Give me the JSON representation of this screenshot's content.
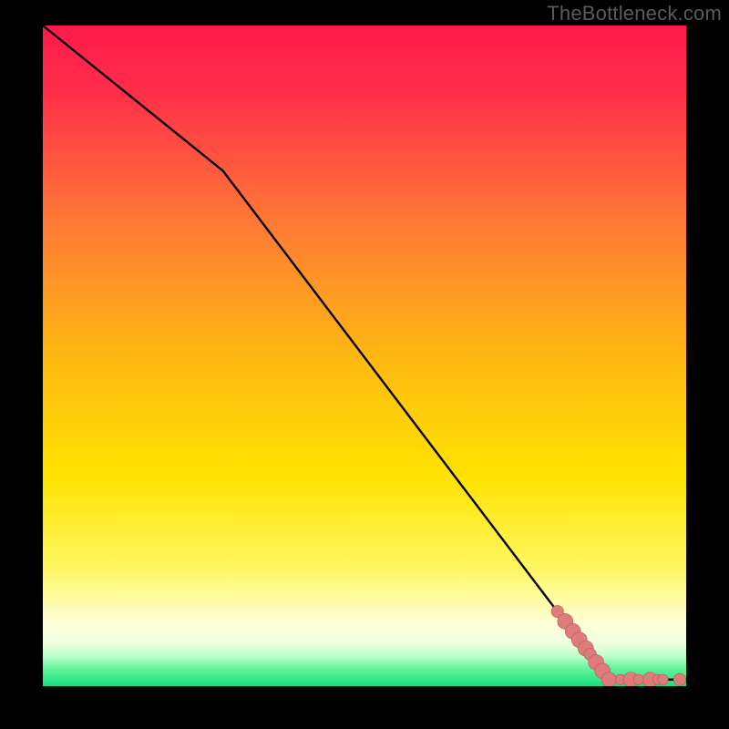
{
  "attribution": "TheBottleneck.com",
  "colors": {
    "background": "#000000",
    "gradient_top": "#ff1a4a",
    "gradient_mid_upper": "#ff8a2a",
    "gradient_mid": "#ffd400",
    "gradient_pale": "#ffffc0",
    "gradient_green_light": "#7dfda0",
    "gradient_green": "#17e07e",
    "curve": "#000000",
    "marker_fill": "#dd7c78",
    "marker_stroke": "#b85a58"
  },
  "chart_data": {
    "type": "line",
    "xlim": [
      0,
      100
    ],
    "ylim": [
      0,
      100
    ],
    "title": "",
    "xlabel": "",
    "ylabel": "",
    "grid": false,
    "curve": [
      {
        "x": 0,
        "y": 100
      },
      {
        "x": 28,
        "y": 78
      },
      {
        "x": 88,
        "y": 1
      },
      {
        "x": 100,
        "y": 1
      }
    ],
    "markers": [
      {
        "x": 80.0,
        "y": 11.3,
        "r": 1.9
      },
      {
        "x": 81.2,
        "y": 9.8,
        "r": 2.4
      },
      {
        "x": 82.4,
        "y": 8.3,
        "r": 2.4
      },
      {
        "x": 83.4,
        "y": 7.0,
        "r": 2.4
      },
      {
        "x": 84.4,
        "y": 5.7,
        "r": 2.4
      },
      {
        "x": 85.1,
        "y": 4.8,
        "r": 1.9
      },
      {
        "x": 86.0,
        "y": 3.6,
        "r": 2.4
      },
      {
        "x": 87.0,
        "y": 2.3,
        "r": 2.4
      },
      {
        "x": 88.0,
        "y": 1.0,
        "r": 2.3
      },
      {
        "x": 89.8,
        "y": 1.0,
        "r": 1.6
      },
      {
        "x": 91.4,
        "y": 1.0,
        "r": 2.3
      },
      {
        "x": 92.6,
        "y": 1.0,
        "r": 1.6
      },
      {
        "x": 94.4,
        "y": 1.0,
        "r": 2.3
      },
      {
        "x": 95.6,
        "y": 1.0,
        "r": 1.6
      },
      {
        "x": 96.4,
        "y": 1.0,
        "r": 1.6
      },
      {
        "x": 99.0,
        "y": 1.0,
        "r": 1.9
      }
    ]
  }
}
